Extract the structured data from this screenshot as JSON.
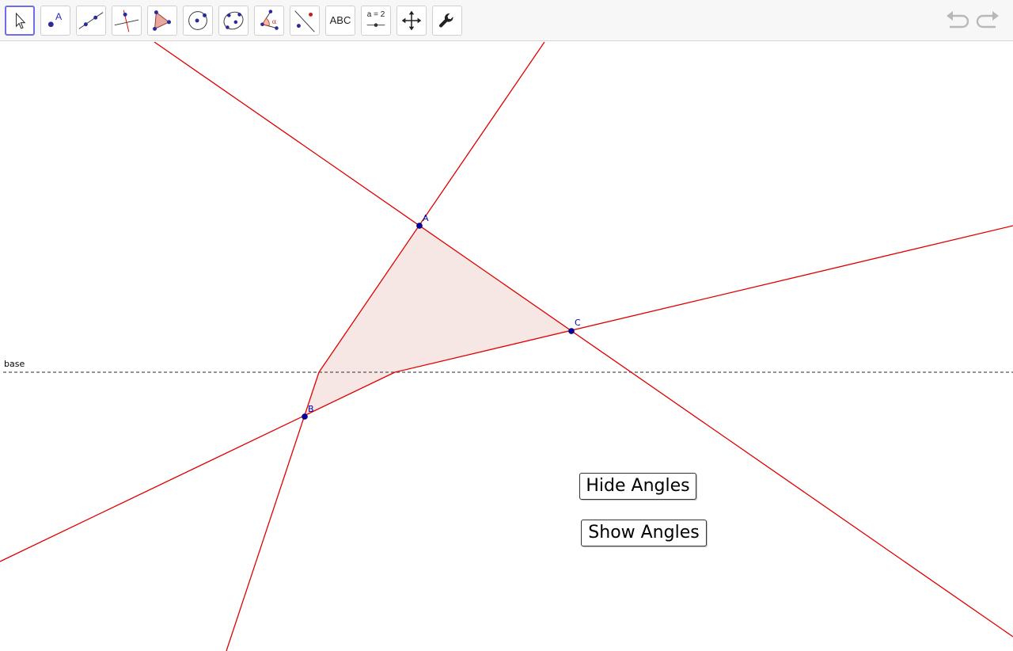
{
  "toolbar": {
    "tools": [
      {
        "name": "move",
        "icon": "move-arrow-icon",
        "active": true
      },
      {
        "name": "point",
        "icon": "point-icon",
        "label": "A"
      },
      {
        "name": "line",
        "icon": "line-icon"
      },
      {
        "name": "perpendicular",
        "icon": "perpendicular-line-icon"
      },
      {
        "name": "polygon",
        "icon": "polygon-icon"
      },
      {
        "name": "circle",
        "icon": "circle-center-point-icon"
      },
      {
        "name": "conic",
        "icon": "conic-five-points-icon"
      },
      {
        "name": "angle",
        "icon": "angle-icon",
        "label": "α"
      },
      {
        "name": "reflect",
        "icon": "reflect-line-icon"
      },
      {
        "name": "text",
        "icon": "text-icon",
        "label": "ABC"
      },
      {
        "name": "slider",
        "icon": "slider-icon",
        "label": "a = 2"
      },
      {
        "name": "move-graphics",
        "icon": "move-graphics-view-icon"
      },
      {
        "name": "tools",
        "icon": "wrench-icon"
      }
    ],
    "undo_icon": "undo-icon",
    "redo_icon": "redo-icon"
  },
  "graphics": {
    "colors": {
      "line": "#e00000",
      "fill": "#f6e7e4",
      "point": "#0000b4",
      "base": "#555555"
    },
    "points": {
      "A": "A",
      "B": "B",
      "C": "C"
    },
    "base_label": "base"
  },
  "buttons": {
    "hide_angles": "Hide Angles",
    "show_angles": "Show Angles"
  }
}
